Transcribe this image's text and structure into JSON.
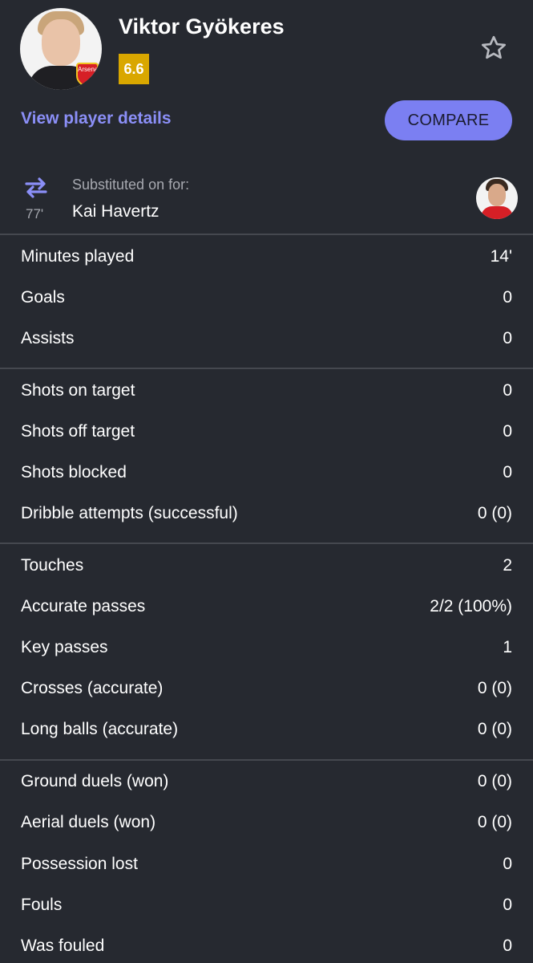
{
  "player": {
    "name": "Viktor Gyökeres",
    "rating": "6.6",
    "club_badge_text": "Arsenal",
    "rating_color": "#d9a700"
  },
  "actions": {
    "view_details": "View player details",
    "compare": "COMPARE",
    "favorite_icon": "star-outline-icon",
    "accent_color": "#7b7ff2"
  },
  "substitution": {
    "icon": "substitution-icon",
    "minute": "77'",
    "label": "Substituted on for:",
    "player_name": "Kai Havertz"
  },
  "stats": [
    {
      "label": "Minutes played",
      "value": "14'"
    },
    {
      "label": "Goals",
      "value": "0"
    },
    {
      "label": "Assists",
      "value": "0"
    },
    {
      "label": "Shots on target",
      "value": "0"
    },
    {
      "label": "Shots off target",
      "value": "0"
    },
    {
      "label": "Shots blocked",
      "value": "0"
    },
    {
      "label": "Dribble attempts (successful)",
      "value": "0 (0)"
    },
    {
      "label": "Touches",
      "value": "2"
    },
    {
      "label": "Accurate passes",
      "value": "2/2 (100%)"
    },
    {
      "label": "Key passes",
      "value": "1"
    },
    {
      "label": "Crosses (accurate)",
      "value": "0 (0)"
    },
    {
      "label": "Long balls (accurate)",
      "value": "0 (0)"
    },
    {
      "label": "Ground duels (won)",
      "value": "0 (0)"
    },
    {
      "label": "Aerial duels (won)",
      "value": "0 (0)"
    },
    {
      "label": "Possession lost",
      "value": "0"
    },
    {
      "label": "Fouls",
      "value": "0"
    },
    {
      "label": "Was fouled",
      "value": "0"
    }
  ]
}
